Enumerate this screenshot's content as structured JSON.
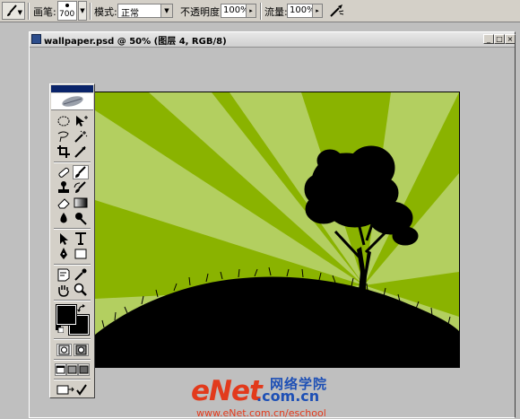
{
  "options_bar": {
    "tool_preset_icon": "brush-icon",
    "brush_label": "画笔:",
    "brush_size": "700",
    "mode_label": "模式:",
    "mode_value": "正常",
    "opacity_label": "不透明度:",
    "opacity_value": "100%",
    "flow_label": "流量:",
    "flow_value": "100%",
    "airbrush_icon": "airbrush-icon"
  },
  "document": {
    "title": "wallpaper.psd @ 50% (图层 4, RGB/8)",
    "buttons": [
      "minimize",
      "maximize",
      "close"
    ],
    "colors": {
      "light_green": "#b3cf60",
      "dark_green": "#8ab300",
      "silhouette": "#000000"
    }
  },
  "toolbox": {
    "tools": [
      [
        "marquee-tool-icon",
        "move-tool-icon"
      ],
      [
        "lasso-tool-icon",
        "magic-wand-tool-icon"
      ],
      [
        "crop-tool-icon",
        "slice-tool-icon"
      ],
      [
        "healing-brush-tool-icon",
        "brush-tool-icon"
      ],
      [
        "clone-stamp-tool-icon",
        "history-brush-tool-icon"
      ],
      [
        "eraser-tool-icon",
        "gradient-tool-icon"
      ],
      [
        "blur-tool-icon",
        "dodge-tool-icon"
      ],
      [
        "path-selection-tool-icon",
        "type-tool-icon"
      ],
      [
        "pen-tool-icon",
        "shape-tool-icon"
      ],
      [
        "notes-tool-icon",
        "eyedropper-tool-icon"
      ],
      [
        "hand-tool-icon",
        "zoom-tool-icon"
      ]
    ],
    "active_tool": "brush-tool-icon",
    "foreground_color": "#000000",
    "background_color": "#000000"
  },
  "watermark": {
    "logo": "eNet",
    "dotcom": ".com.cn",
    "cn": "网络学院",
    "url": "www.eNet.com.cn/eschool"
  }
}
